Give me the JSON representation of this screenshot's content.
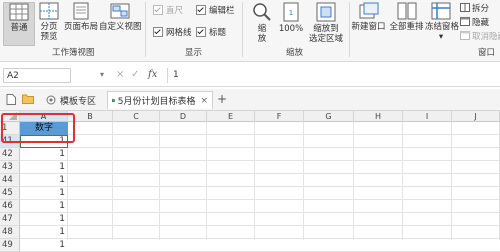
{
  "ribbon": {
    "views": [
      {
        "label": "普通",
        "active": true
      },
      {
        "label": "分页\n预览"
      },
      {
        "label": "页面布局"
      },
      {
        "label": "自定义视图"
      }
    ],
    "views_group_label": "工作簿视图",
    "show_items": [
      {
        "label": "直尺",
        "checked": true,
        "disabled": true
      },
      {
        "label": "编辑栏",
        "checked": true
      },
      {
        "label": "网格线",
        "checked": true
      },
      {
        "label": "标题",
        "checked": true
      }
    ],
    "show_group_label": "显示",
    "zoom_buttons": [
      {
        "label": "缩\n放"
      },
      {
        "label": "100%"
      },
      {
        "label": "缩放到\n选定区域"
      }
    ],
    "zoom_group_label": "缩放",
    "window_buttons": [
      {
        "label": "新建窗口"
      },
      {
        "label": "全部重排"
      },
      {
        "label": "冻结窗格"
      }
    ],
    "window_small": [
      {
        "label": "拆分"
      },
      {
        "label": "隐藏"
      },
      {
        "label": "取消隐藏"
      }
    ],
    "window_group_label": "窗口"
  },
  "formula_bar": {
    "name_box": "A2",
    "dropdown_icon": "▾",
    "cancel_icon": "×",
    "confirm_icon": "✓",
    "fx_label": "fx",
    "value": "1"
  },
  "tabs": [
    {
      "label": "模板专区",
      "icon": "template-icon"
    },
    {
      "label": "5月份计划目标表格",
      "icon": "excel-file-icon",
      "active": true
    }
  ],
  "tab_close": "×",
  "tab_add": "+",
  "grid": {
    "columns": [
      "A",
      "B",
      "C",
      "D",
      "E",
      "F",
      "G",
      "H",
      "I",
      "J"
    ],
    "rows": [
      {
        "header": "1",
        "a": "数字"
      },
      {
        "header": "41",
        "a": "1"
      },
      {
        "header": "42",
        "a": "1"
      },
      {
        "header": "43",
        "a": "1"
      },
      {
        "header": "44",
        "a": "1"
      },
      {
        "header": "45",
        "a": "1"
      },
      {
        "header": "46",
        "a": "1"
      },
      {
        "header": "47",
        "a": "1"
      },
      {
        "header": "48",
        "a": "1"
      },
      {
        "header": "49",
        "a": "1"
      }
    ],
    "highlight_color": "#e0312b",
    "header_fill": "#5b9bd5"
  }
}
